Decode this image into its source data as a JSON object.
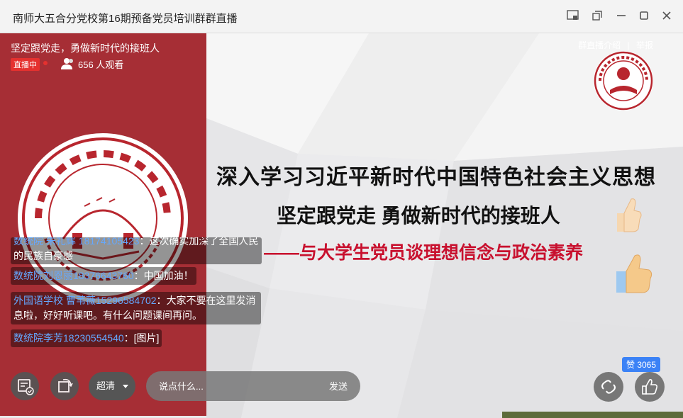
{
  "window": {
    "title": "南师大五合分党校第16期预备党员培训群群直播"
  },
  "live": {
    "title": "坚定跟党走，勇做新时代的接班人",
    "status_badge": "直播中",
    "viewers": "656 人观看",
    "links": [
      "群直播介绍",
      "|",
      "举报"
    ]
  },
  "slide": {
    "line1": "深入学习习近平新时代中国特色社会主义思想",
    "line2": "坚定跟党走  勇做新时代的接班人",
    "line3": "——与大学生党员谈理想信念与政治素养"
  },
  "chat": [
    {
      "user": "数统院 朱礼辉 18174105423",
      "text": "：这次确实加深了全国人民的民族自豪感"
    },
    {
      "user": "数统院刘恩丽18376643760",
      "text": "：中国加油！"
    },
    {
      "user": "外国语学校 曹苇薇15296584702",
      "text": "：大家不要在这里发消息啦，好好听课吧。有什么问题课间再问。"
    },
    {
      "user": "数统院李芳18230554540",
      "text": "：[图片]"
    }
  ],
  "controls": {
    "quality": "超清",
    "comment_placeholder": "说点什么...",
    "send": "发送",
    "like_count": "赞 3065"
  },
  "colors": {
    "left_band": "#a62e35",
    "live_badge": "#e5312f",
    "username": "#64a8ff",
    "slide_red": "#c8102e",
    "like_badge": "#3b82f6"
  },
  "icons": [
    "minimize-to-float-icon",
    "popout-icon",
    "minimize-icon",
    "maximize-icon",
    "close-icon",
    "viewers-icon",
    "document-check-icon",
    "rotate-icon",
    "share-icon",
    "thumbs-up-icon"
  ]
}
